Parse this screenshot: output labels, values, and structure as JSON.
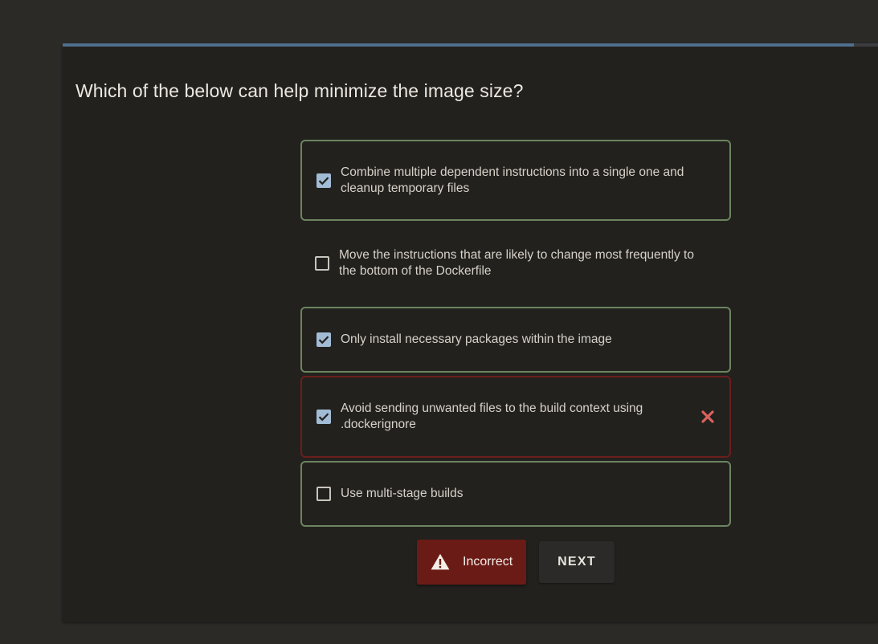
{
  "progress": {
    "fraction": 0.97,
    "color": "#4f6f8f"
  },
  "question": "Which of the below can help minimize the image size?",
  "options": [
    {
      "label": "Combine multiple dependent instructions into a single one and cleanup temporary files",
      "checked": true,
      "state": "correct"
    },
    {
      "label": "Move the instructions that are likely to change most frequently to the bottom of the Dockerfile",
      "checked": false,
      "state": "none"
    },
    {
      "label": "Only install necessary packages within the image",
      "checked": true,
      "state": "correct"
    },
    {
      "label": "Avoid sending unwanted files to the build context using .dockerignore",
      "checked": true,
      "state": "wrong",
      "icon": "close-icon"
    },
    {
      "label": "Use multi-stage builds",
      "checked": false,
      "state": "correct"
    }
  ],
  "result": {
    "label": "Incorrect",
    "icon": "warning-icon",
    "color": "#6b1b16"
  },
  "next_label": "NEXT",
  "colors": {
    "correct_border": "#6b845f",
    "wrong_border": "#6b1e1c",
    "checkbox_fill": "#a2bcd6",
    "wrong_mark": "#d9625d"
  }
}
